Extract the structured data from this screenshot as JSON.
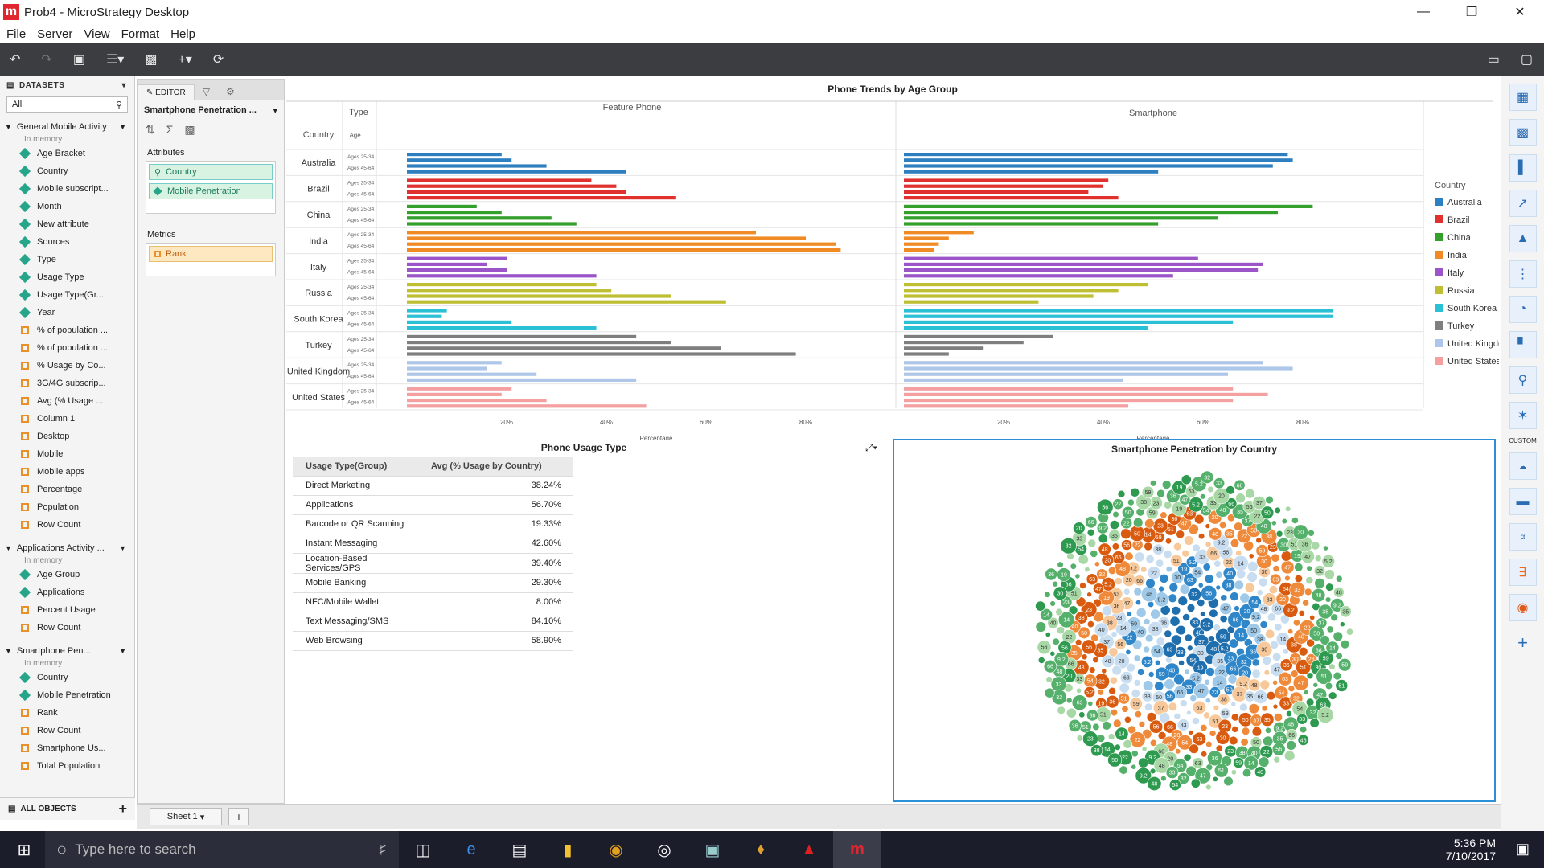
{
  "window": {
    "title": "Prob4 - MicroStrategy Desktop",
    "logo": "m"
  },
  "menu": [
    "File",
    "Server",
    "View",
    "Format",
    "Help"
  ],
  "toolbar_icons": [
    "undo-icon",
    "redo-icon",
    "save-icon",
    "add-data-icon",
    "add-visualization-icon",
    "add-icon",
    "refresh-icon"
  ],
  "datasets": {
    "header": "DATASETS",
    "filter_value": "All",
    "all_objects": "ALL OBJECTS",
    "groups": [
      {
        "name": "General Mobile Activity",
        "sub": "In memory",
        "items": [
          {
            "t": "a",
            "l": "Age Bracket"
          },
          {
            "t": "a",
            "l": "Country"
          },
          {
            "t": "a",
            "l": "Mobile subscript..."
          },
          {
            "t": "a",
            "l": "Month"
          },
          {
            "t": "a",
            "l": "New attribute"
          },
          {
            "t": "a",
            "l": "Sources"
          },
          {
            "t": "a",
            "l": "Type"
          },
          {
            "t": "a",
            "l": "Usage Type"
          },
          {
            "t": "a",
            "l": "Usage Type(Gr..."
          },
          {
            "t": "a",
            "l": "Year"
          },
          {
            "t": "m",
            "l": "% of population ..."
          },
          {
            "t": "m",
            "l": "% of population ..."
          },
          {
            "t": "m",
            "l": "% Usage by Co..."
          },
          {
            "t": "m",
            "l": "3G/4G subscrip..."
          },
          {
            "t": "m",
            "l": "Avg (% Usage ..."
          },
          {
            "t": "m",
            "l": "Column 1"
          },
          {
            "t": "m",
            "l": "Desktop"
          },
          {
            "t": "m",
            "l": "Mobile"
          },
          {
            "t": "m",
            "l": "Mobile apps"
          },
          {
            "t": "m",
            "l": "Percentage"
          },
          {
            "t": "m",
            "l": "Population"
          },
          {
            "t": "m",
            "l": "Row Count"
          }
        ]
      },
      {
        "name": "Applications Activity ...",
        "sub": "In memory",
        "items": [
          {
            "t": "a",
            "l": "Age Group"
          },
          {
            "t": "a",
            "l": "Applications"
          },
          {
            "t": "m",
            "l": "Percent Usage"
          },
          {
            "t": "m",
            "l": "Row Count"
          }
        ]
      },
      {
        "name": "Smartphone Pen...",
        "sub": "In memory",
        "items": [
          {
            "t": "a",
            "l": "Country"
          },
          {
            "t": "a",
            "l": "Mobile Penetration"
          },
          {
            "t": "m",
            "l": "Rank"
          },
          {
            "t": "m",
            "l": "Row Count"
          },
          {
            "t": "m",
            "l": "Smartphone Us..."
          },
          {
            "t": "m",
            "l": "Total Population"
          }
        ]
      }
    ]
  },
  "editor": {
    "tab": "EDITOR",
    "viz_name": "Smartphone Penetration ...",
    "attributes_label": "Attributes",
    "attributes": [
      "Country",
      "Mobile Penetration"
    ],
    "metrics_label": "Metrics",
    "metrics": [
      "Rank"
    ]
  },
  "sheet": {
    "tab": "Sheet 1"
  },
  "trends": {
    "title": "Phone Trends by Age Group",
    "type_label": "Type",
    "country_label": "Country",
    "age_label": "Age ...",
    "col_feature": "Feature Phone",
    "col_smart": "Smartphone",
    "xlabel": "Percentage",
    "ticks": [
      "20%",
      "40%",
      "60%",
      "80%"
    ],
    "age_rows": [
      "Ages 25-34",
      "Ages 45-64"
    ],
    "legend_title": "Country"
  },
  "chart_data": {
    "type": "bar",
    "title": "Phone Trends by Age Group",
    "xlabel": "Percentage",
    "xlim": [
      0,
      1
    ],
    "categories": [
      "Australia",
      "Brazil",
      "China",
      "India",
      "Italy",
      "Russia",
      "South Korea",
      "Turkey",
      "United Kingdom",
      "United States"
    ],
    "colors": [
      "#2e7fbf",
      "#e0312f",
      "#33a02c",
      "#f08a24",
      "#9b55c8",
      "#bfbf33",
      "#2bc0d6",
      "#7f7f7f",
      "#aec7e8",
      "#f4a0a0"
    ],
    "series": [
      {
        "name": "Feature Phone",
        "values": [
          [
            0.19,
            0.21,
            0.28,
            0.44
          ],
          [
            0.37,
            0.42,
            0.44,
            0.54
          ],
          [
            0.14,
            0.19,
            0.29,
            0.34
          ],
          [
            0.7,
            0.8,
            0.86,
            0.87
          ],
          [
            0.2,
            0.16,
            0.2,
            0.38
          ],
          [
            0.38,
            0.41,
            0.53,
            0.64
          ],
          [
            0.08,
            0.07,
            0.21,
            0.38
          ],
          [
            0.46,
            0.53,
            0.63,
            0.78
          ],
          [
            0.19,
            0.16,
            0.26,
            0.46
          ],
          [
            0.21,
            0.19,
            0.28,
            0.48
          ]
        ]
      },
      {
        "name": "Smartphone",
        "values": [
          [
            0.77,
            0.78,
            0.74,
            0.51
          ],
          [
            0.41,
            0.4,
            0.37,
            0.43
          ],
          [
            0.82,
            0.75,
            0.63,
            0.51
          ],
          [
            0.14,
            0.09,
            0.07,
            0.06
          ],
          [
            0.59,
            0.72,
            0.71,
            0.54
          ],
          [
            0.49,
            0.43,
            0.38,
            0.27
          ],
          [
            0.86,
            0.86,
            0.66,
            0.49
          ],
          [
            0.3,
            0.24,
            0.16,
            0.09
          ],
          [
            0.72,
            0.78,
            0.65,
            0.44
          ],
          [
            0.66,
            0.73,
            0.66,
            0.45
          ]
        ]
      }
    ]
  },
  "usage": {
    "title": "Phone Usage Type",
    "headers": [
      "Usage Type(Group)",
      "Avg (% Usage by Country)"
    ],
    "rows": [
      [
        "Direct Marketing",
        "38.24%"
      ],
      [
        "Applications",
        "56.70%"
      ],
      [
        "Barcode or QR Scanning",
        "19.33%"
      ],
      [
        "Instant Messaging",
        "42.60%"
      ],
      [
        "Location-Based Services/GPS",
        "39.40%"
      ],
      [
        "Mobile Banking",
        "29.30%"
      ],
      [
        "NFC/Mobile Wallet",
        "8.00%"
      ],
      [
        "Text Messaging/SMS",
        "84.10%"
      ],
      [
        "Web Browsing",
        "58.90%"
      ]
    ]
  },
  "penetration": {
    "title": "Smartphone Penetration by Country",
    "labels": [
      "40",
      "36",
      "33",
      "37",
      "23",
      "5.2",
      "9.2",
      "14",
      "19",
      "20",
      "22",
      "30",
      "32",
      "35",
      "38",
      "47",
      "48",
      "50",
      "51",
      "54",
      "56",
      "59",
      "63",
      "66"
    ]
  },
  "right_icons": [
    "grid-icon",
    "heatmap-icon",
    "bar-chart-icon",
    "line-chart-icon",
    "area-chart-icon",
    "bubble-chart-icon",
    "pie-chart-icon",
    "combo-chart-icon",
    "map-icon",
    "network-icon"
  ],
  "custom_label": "CUSTOM",
  "custom_icons": [
    "word-cloud-icon",
    "gantt-icon",
    "abc-icon",
    "d3-icon",
    "wheel-icon",
    "plus-icon"
  ],
  "taskbar": {
    "search_placeholder": "Type here to search",
    "time": "5:36 PM",
    "date": "7/10/2017"
  }
}
